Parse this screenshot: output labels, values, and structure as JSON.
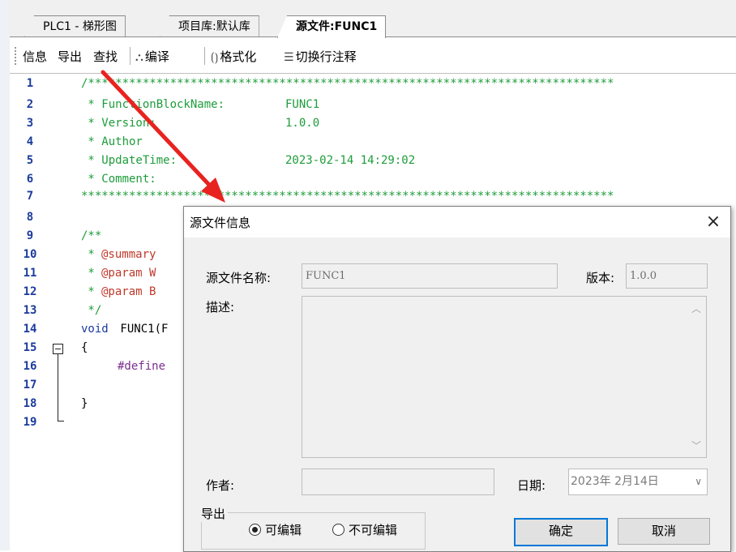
{
  "tabs": [
    "PLC1 - 梯形图",
    "项目库:默认库",
    "源文件:FUNC1"
  ],
  "toolbar": {
    "info": "信息",
    "export": "导出",
    "find": "查找",
    "compile": "编译",
    "format": "格式化",
    "toggle_comment": "切换行注释",
    "compile_icon": "compile-icon",
    "format_icon": "braces-icon",
    "comment_icon": "lines-icon"
  },
  "editor": {
    "line_numbers": [
      "1",
      "2",
      "3",
      "4",
      "5",
      "6",
      "7",
      "8",
      "9",
      "10",
      "11",
      "12",
      "13",
      "14",
      "15",
      "16",
      "17",
      "18",
      "19"
    ],
    "l1": "/*****************************************************************************",
    "l2_key": " * FunctionBlockName:",
    "l2_val": "FUNC1",
    "l3_key": " * Version:",
    "l3_val": "1.0.0",
    "l4_key": " * Author",
    "l5_key": " * UpdateTime:",
    "l5_val": "2023-02-14 14:29:02",
    "l6_key": " * Comment:",
    "l7": "******************************************************************************",
    "l9": "/**",
    "l10_star": " * ",
    "l10_ann": "@summary",
    "l11_star": " * ",
    "l11_ann": "@param W",
    "l12_star": " * ",
    "l12_ann": "@param B",
    "l13": " */",
    "l14_kw": "void",
    "l14_rest": " FUNC1(F",
    "l15": "{",
    "l16": "#define",
    "l18": "}"
  },
  "dialog": {
    "title": "源文件信息",
    "close": "×",
    "name_label": "源文件名称:",
    "name_value": "FUNC1",
    "version_label": "版本:",
    "version_value": "1.0.0",
    "desc_label": "描述:",
    "author_label": "作者:",
    "author_value": "",
    "date_label": "日期:",
    "date_value": "2023年 2月14日",
    "export_group": "导出",
    "radio_editable": "可编辑",
    "radio_noneditable": "不可编辑",
    "ok": "确定",
    "cancel": "取消"
  },
  "colors": {
    "comment": "#1d9c3a",
    "line_number": "#1b3b9c",
    "annotation": "#c0392b",
    "arrow": "#e8231f",
    "default_button_border": "#0078d7"
  }
}
